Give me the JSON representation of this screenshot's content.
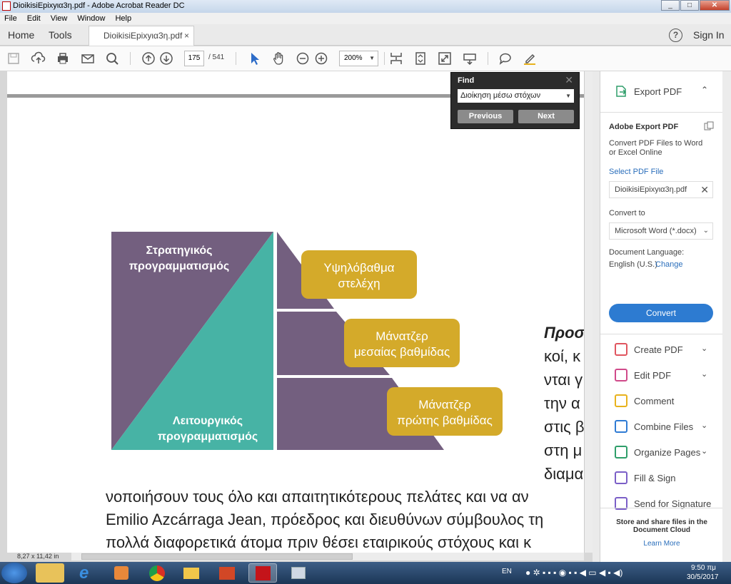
{
  "window": {
    "title": "DioikisiEpixyια3η.pdf - Adobe Acrobat Reader DC",
    "min": "_",
    "max": "□",
    "close": "✕"
  },
  "menu": [
    "File",
    "Edit",
    "View",
    "Window",
    "Help"
  ],
  "tabs": {
    "home": "Home",
    "tools": "Tools",
    "doc": "DioikisiEpixyια3η.pdf",
    "doc_close": "×",
    "help": "?",
    "sign_in": "Sign In"
  },
  "toolbar": {
    "page_current": "175",
    "page_total": "/ 541",
    "zoom": "200%"
  },
  "find": {
    "title": "Find",
    "close": "✕",
    "query": "Διοίκηση μέσω στόχων",
    "previous": "Previous",
    "next": "Next"
  },
  "diagram": {
    "strategic": [
      "Στρατηγικός",
      "προγραμματισμός"
    ],
    "operational": [
      "Λειτουργικός",
      "προγραμματισμός"
    ],
    "levels": [
      [
        "Υψηλόβαθμα",
        "στελέχη"
      ],
      [
        "Μάνατζερ",
        "μεσαίας βαθμίδας"
      ],
      [
        "Μάνατζερ",
        "πρώτης βαθμίδας"
      ]
    ],
    "colors": {
      "purple": "#735f7f",
      "teal": "#47b3a5",
      "gold": "#d4aa2a"
    }
  },
  "right_text": [
    "Προσ",
    "κοί, κ",
    "νται γ",
    "την α",
    "στις β",
    "στη μ",
    "διαμα"
  ],
  "body_lines": [
    "νοποιήσουν τους όλο και απαιτητικότερους πελάτες και να αν",
    "Emilio Azcárraga Jean, πρόεδρος και διευθύνων σύμβουλος τη",
    "πολλά διαφορετικά άτομα πριν θέσει εταιρικούς στόχους και κ"
  ],
  "status": {
    "page_size": "8,27 x 11,42 in"
  },
  "side": {
    "export_pdf": "Export PDF",
    "adobe_export": "Adobe Export PDF",
    "desc": [
      "Convert PDF Files to Word",
      "or Excel Online"
    ],
    "select_file": "Select PDF File",
    "file": "DioikisiEpixyια3η.pdf",
    "convert_to": "Convert to",
    "format": "Microsoft Word (*.docx)",
    "doc_lang": "Document Language:",
    "lang": "English (U.S.)",
    "change": "Change",
    "convert_btn": "Convert",
    "tools": [
      {
        "label": "Create PDF",
        "icon": "create-pdf-icon",
        "color": "#e0555f",
        "chevron": true
      },
      {
        "label": "Edit PDF",
        "icon": "edit-pdf-icon",
        "color": "#d04a8a",
        "chevron": true
      },
      {
        "label": "Comment",
        "icon": "comment-icon",
        "color": "#e8b21d",
        "chevron": false
      },
      {
        "label": "Combine Files",
        "icon": "combine-files-icon",
        "color": "#2f7bd4",
        "chevron": true
      },
      {
        "label": "Organize Pages",
        "icon": "organize-pages-icon",
        "color": "#2f9e6a",
        "chevron": true
      },
      {
        "label": "Fill & Sign",
        "icon": "fill-sign-icon",
        "color": "#7b5fc7",
        "chevron": false
      },
      {
        "label": "Send for Signature",
        "icon": "send-signature-icon",
        "color": "#7b5fc7",
        "chevron": false
      }
    ],
    "footer": [
      "Store and share files in the",
      "Document Cloud"
    ],
    "learn_more": "Learn More"
  },
  "taskbar": {
    "lang": "EN",
    "time": "9:50 πμ",
    "date": "30/5/2017"
  }
}
